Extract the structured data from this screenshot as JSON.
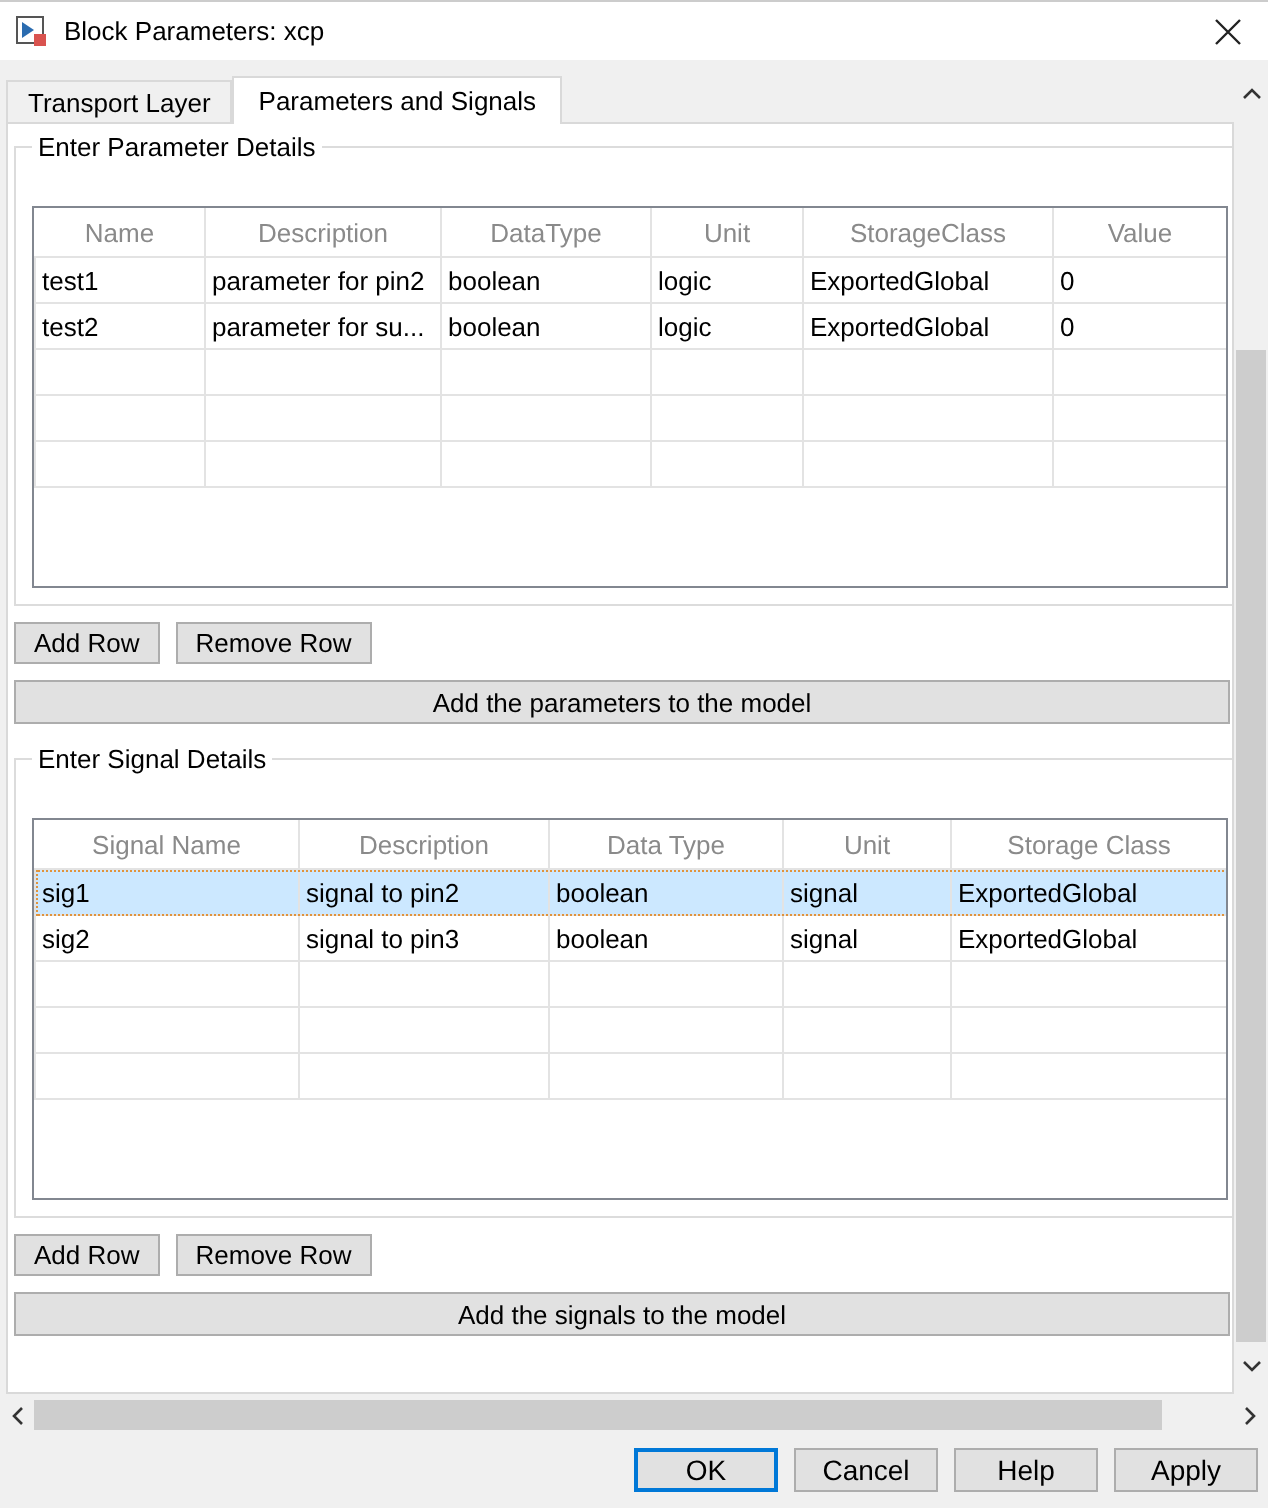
{
  "window": {
    "title": "Block Parameters: xcp"
  },
  "tabs": [
    {
      "label": "Transport Layer",
      "selected": false
    },
    {
      "label": "Parameters and Signals",
      "selected": true
    }
  ],
  "parameters": {
    "legend": "Enter Parameter Details",
    "columns": [
      "Name",
      "Description",
      "DataType",
      "Unit",
      "StorageClass",
      "Value"
    ],
    "rows": [
      {
        "cells": [
          "test1",
          "parameter for pin2",
          "boolean",
          "logic",
          "ExportedGlobal",
          "0"
        ],
        "selected": false
      },
      {
        "cells": [
          "test2",
          "parameter for su...",
          "boolean",
          "logic",
          "ExportedGlobal",
          "0"
        ],
        "selected": false
      }
    ],
    "buttons": [
      "Add Row",
      "Remove Row"
    ],
    "apply_button": "Add the parameters to the model"
  },
  "signals": {
    "legend": "Enter Signal Details",
    "columns": [
      "Signal Name",
      "Description",
      "Data Type",
      "Unit",
      "Storage Class"
    ],
    "rows": [
      {
        "cells": [
          "sig1",
          "signal to pin2",
          "boolean",
          "signal",
          "ExportedGlobal"
        ],
        "selected": true
      },
      {
        "cells": [
          "sig2",
          "signal to pin3",
          "boolean",
          "signal",
          "ExportedGlobal"
        ],
        "selected": false
      }
    ],
    "buttons": [
      "Add Row",
      "Remove Row"
    ],
    "apply_button": "Add the signals to the model"
  },
  "dialog_buttons": [
    {
      "label": "OK",
      "default": true
    },
    {
      "label": "Cancel",
      "default": false
    },
    {
      "label": "Help",
      "default": false
    },
    {
      "label": "Apply",
      "default": false
    }
  ]
}
